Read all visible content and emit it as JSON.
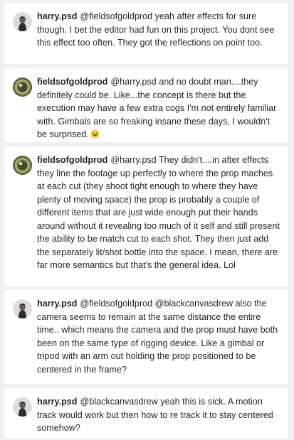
{
  "comments": [
    {
      "username": "harry.psd",
      "text": "@fieldsofgoldprod yeah after effects for sure though. I bet the editor had fun on this project. You dont see this effect too often. They got the reflections on point too.",
      "avatar": "harry-avatar"
    },
    {
      "username": "fieldsofgoldprod",
      "text": "@harry.psd and no doubt man....they definitely could be. Like...the concept is there but the execution may have a few extra cogs I'm not entirely familiar with. Gimbals are so freaking insane these days, I wouldn't be surprised.",
      "emoji": "grinning-sweat-emoji",
      "avatar": "fields-avatar"
    },
    {
      "username": "fieldsofgoldprod",
      "text": "@harry.psd They didn't....in after effects they line the footage up perfectly to where the prop maches at each cut (they shoot tight enough to where they have plenty of moving space) the prop is probably a couple of different items that are just wide enough put their hands around without it revealing too much of it self and still present the ability to be match cut to each shot. They then just add the separately lit/shot bottle into the space. I mean, there are far more semantics but that's the general idea. Lol",
      "avatar": "fields-avatar"
    },
    {
      "username": "harry.psd",
      "text": "@fieldsofgoldprod @blackcanvasdrew also the camera seems to remain at the same distance the entire time.. which means the camera and the prop must have both been on the same type of rigging device. Like a gimbal or tripod with an arm out holding the prop positioned to be centered in the frame?",
      "avatar": "harry-avatar"
    },
    {
      "username": "harry.psd",
      "text": "@blackcanvasdrew yeah this is sick. A motion track would work but then how to re track it to stay centered somehow?",
      "avatar": "harry-avatar"
    }
  ],
  "colors": {
    "background": "#f0f0f2",
    "card": "#ffffff",
    "text": "#262626"
  }
}
